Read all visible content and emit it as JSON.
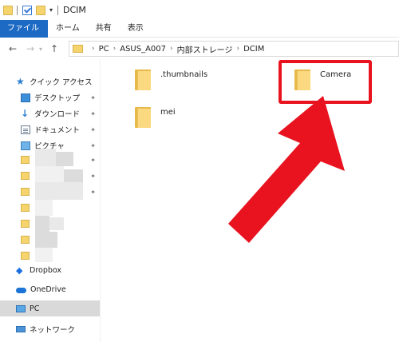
{
  "titlebar": {
    "title": "DCIM"
  },
  "ribbon": {
    "tabs": [
      "ファイル",
      "ホーム",
      "共有",
      "表示"
    ]
  },
  "address": {
    "crumbs": [
      "PC",
      "ASUS_A007",
      "内部ストレージ",
      "DCIM"
    ]
  },
  "sidebar": {
    "quick_access": "クイック アクセス",
    "desktop": "デスクトップ",
    "downloads": "ダウンロード",
    "documents": "ドキュメント",
    "pictures": "ピクチャ",
    "dropbox": "Dropbox",
    "onedrive": "OneDrive",
    "pc": "PC",
    "network": "ネットワーク"
  },
  "content": {
    "folders": [
      ".thumbnails",
      "Camera",
      "mei"
    ]
  },
  "colors": {
    "highlight": "#e8131f",
    "file_tab": "#1c6ac4",
    "selected_nav": "#d9d9d9"
  }
}
